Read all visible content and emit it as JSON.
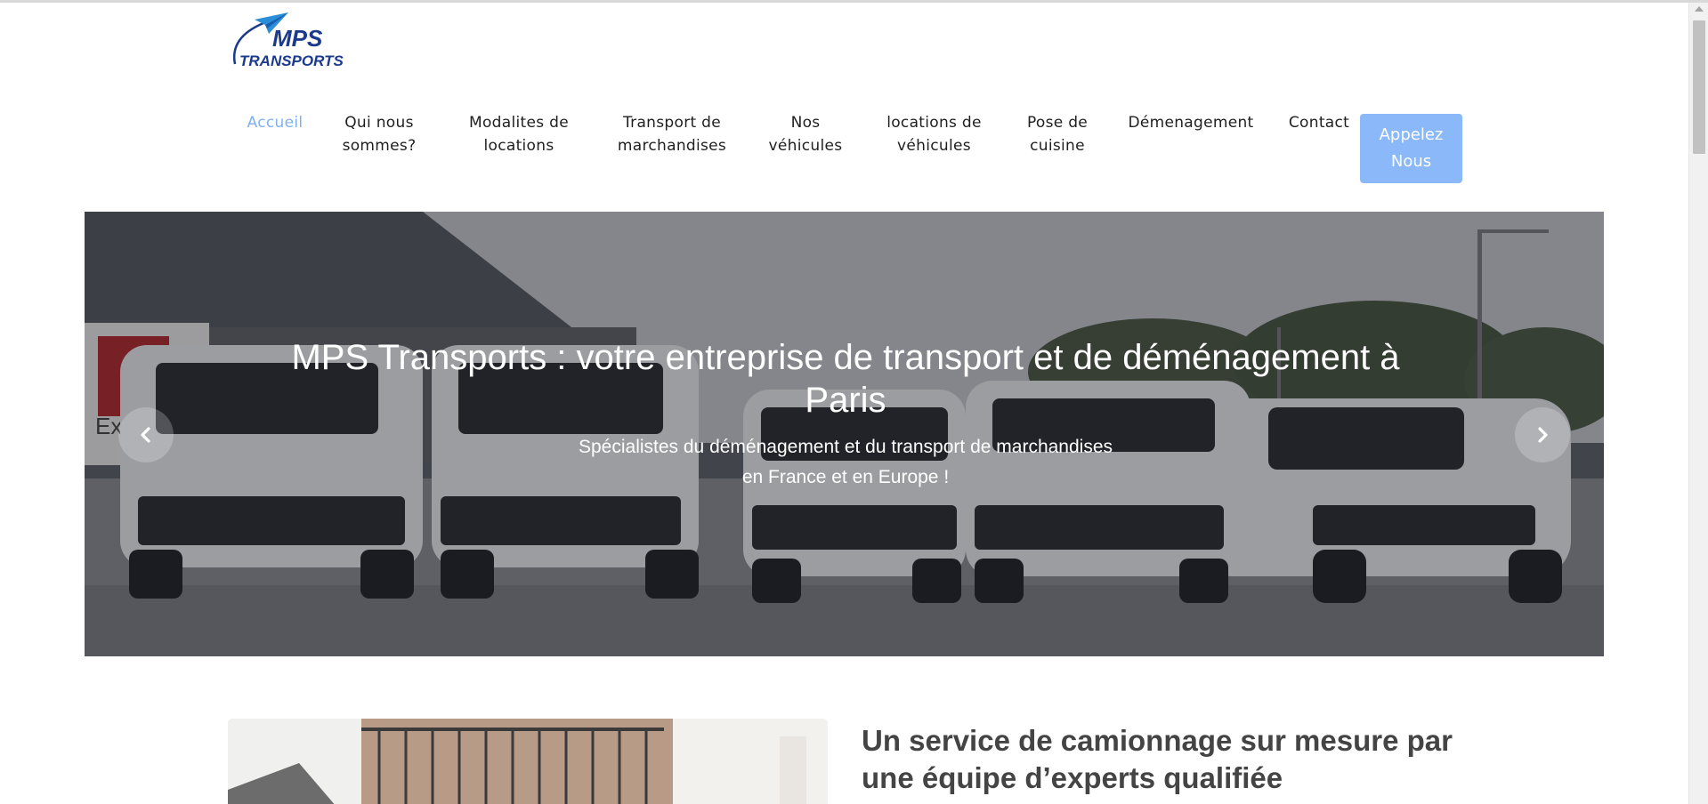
{
  "logo": {
    "line1": "MPS",
    "line2": "TRANSPORTS",
    "icon": "paper-plane-icon",
    "colors": {
      "primary": "#1b3a8c",
      "accent": "#2a8fd8"
    }
  },
  "nav": {
    "items": [
      {
        "label_line1": "Accueil",
        "label_line2": "",
        "active": true
      },
      {
        "label_line1": "Qui nous",
        "label_line2": "sommes?"
      },
      {
        "label_line1": "Modalites de",
        "label_line2": "locations"
      },
      {
        "label_line1": "Transport de",
        "label_line2": "marchandises"
      },
      {
        "label_line1": "Nos",
        "label_line2": "véhicules"
      },
      {
        "label_line1": "locations de",
        "label_line2": "véhicules"
      },
      {
        "label_line1": "Pose de",
        "label_line2": "cuisine"
      },
      {
        "label_line1": "Démenagement",
        "label_line2": ""
      },
      {
        "label_line1": "Contact",
        "label_line2": ""
      }
    ],
    "cta": {
      "line1": "Appelez",
      "line2": "Nous",
      "color": "#8ab8f8"
    },
    "active_color": "#7fb1f0"
  },
  "hero": {
    "title": "MPS Transports : votre entreprise de transport et de déménagement à Paris",
    "subtitle": "Spécialistes du déménagement et du transport de marchandises en France et en Europe !",
    "prev_icon": "chevron-left-icon",
    "next_icon": "chevron-right-icon",
    "bg_label": "Expres"
  },
  "about": {
    "heading_line1": "Un service de camionnage sur mesure par",
    "heading_line2": "une équipe d’experts qualifiée"
  }
}
